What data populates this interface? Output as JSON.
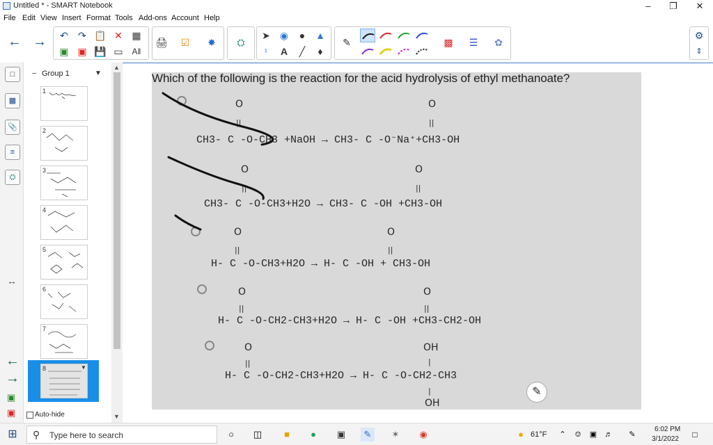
{
  "window": {
    "title": "Untitled * - SMART Notebook",
    "min_glyph": "–",
    "restore_glyph": "❐",
    "close_glyph": "✕"
  },
  "menu": [
    "File",
    "Edit",
    "View",
    "Insert",
    "Format",
    "Tools",
    "Add-ons",
    "Account",
    "Help"
  ],
  "toolbar": {
    "text_tool_label": "A",
    "pen_colors": [
      "#1a1a1a",
      "#d42a2a",
      "#2aa62a",
      "#2a4fd4",
      "#8a2ad4",
      "#e0d01a",
      "#d42ad4",
      "#1a1a1a"
    ]
  },
  "sorter": {
    "group_label": "Group 1",
    "pages": [
      "1",
      "2",
      "3",
      "4",
      "5",
      "6",
      "7",
      "8"
    ],
    "auto_hide_label": "Auto-hide"
  },
  "question": {
    "text": "Which of the following is the reaction for the acid hydrolysis of ethyl methanoate?",
    "o": "O",
    "dbl": "||",
    "vert": "|",
    "oh": "OH",
    "options": [
      {
        "eq": "CH3- C -O-CH3 +NaOH → CH3- C -O⁻Na⁺+CH3-OH"
      },
      {
        "eq": "CH3- C -O-CH3+H2O → CH3- C -OH +CH3-OH"
      },
      {
        "eq": "H- C -O-CH3+H2O → H- C -OH + CH3-OH"
      },
      {
        "eq": "H- C -O-CH2-CH3+H2O → H- C -OH +CH3-CH2-OH"
      },
      {
        "eq": "H- C -O-CH2-CH3+H2O → H- C -O-CH2-CH3"
      }
    ],
    "last_bottom": "OH"
  },
  "taskbar": {
    "search_placeholder": "Type here to search",
    "weather": "61°F",
    "time": "6:02 PM",
    "date": "3/1/2022"
  }
}
